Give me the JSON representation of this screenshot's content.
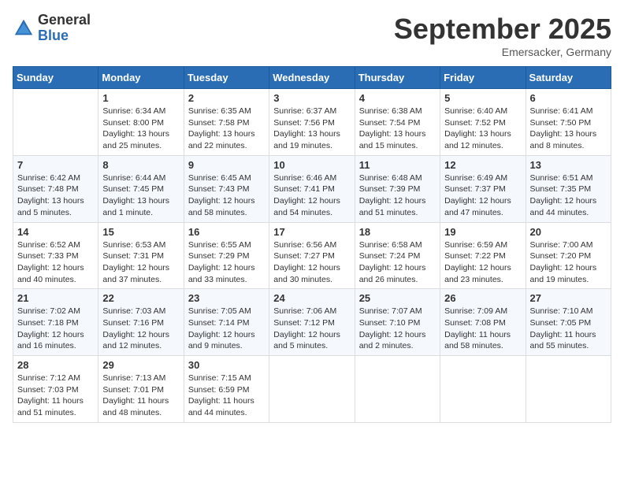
{
  "header": {
    "logo_general": "General",
    "logo_blue": "Blue",
    "month_title": "September 2025",
    "location": "Emersacker, Germany"
  },
  "weekdays": [
    "Sunday",
    "Monday",
    "Tuesday",
    "Wednesday",
    "Thursday",
    "Friday",
    "Saturday"
  ],
  "weeks": [
    [
      {
        "day": "",
        "info": ""
      },
      {
        "day": "1",
        "info": "Sunrise: 6:34 AM\nSunset: 8:00 PM\nDaylight: 13 hours\nand 25 minutes."
      },
      {
        "day": "2",
        "info": "Sunrise: 6:35 AM\nSunset: 7:58 PM\nDaylight: 13 hours\nand 22 minutes."
      },
      {
        "day": "3",
        "info": "Sunrise: 6:37 AM\nSunset: 7:56 PM\nDaylight: 13 hours\nand 19 minutes."
      },
      {
        "day": "4",
        "info": "Sunrise: 6:38 AM\nSunset: 7:54 PM\nDaylight: 13 hours\nand 15 minutes."
      },
      {
        "day": "5",
        "info": "Sunrise: 6:40 AM\nSunset: 7:52 PM\nDaylight: 13 hours\nand 12 minutes."
      },
      {
        "day": "6",
        "info": "Sunrise: 6:41 AM\nSunset: 7:50 PM\nDaylight: 13 hours\nand 8 minutes."
      }
    ],
    [
      {
        "day": "7",
        "info": "Sunrise: 6:42 AM\nSunset: 7:48 PM\nDaylight: 13 hours\nand 5 minutes."
      },
      {
        "day": "8",
        "info": "Sunrise: 6:44 AM\nSunset: 7:45 PM\nDaylight: 13 hours\nand 1 minute."
      },
      {
        "day": "9",
        "info": "Sunrise: 6:45 AM\nSunset: 7:43 PM\nDaylight: 12 hours\nand 58 minutes."
      },
      {
        "day": "10",
        "info": "Sunrise: 6:46 AM\nSunset: 7:41 PM\nDaylight: 12 hours\nand 54 minutes."
      },
      {
        "day": "11",
        "info": "Sunrise: 6:48 AM\nSunset: 7:39 PM\nDaylight: 12 hours\nand 51 minutes."
      },
      {
        "day": "12",
        "info": "Sunrise: 6:49 AM\nSunset: 7:37 PM\nDaylight: 12 hours\nand 47 minutes."
      },
      {
        "day": "13",
        "info": "Sunrise: 6:51 AM\nSunset: 7:35 PM\nDaylight: 12 hours\nand 44 minutes."
      }
    ],
    [
      {
        "day": "14",
        "info": "Sunrise: 6:52 AM\nSunset: 7:33 PM\nDaylight: 12 hours\nand 40 minutes."
      },
      {
        "day": "15",
        "info": "Sunrise: 6:53 AM\nSunset: 7:31 PM\nDaylight: 12 hours\nand 37 minutes."
      },
      {
        "day": "16",
        "info": "Sunrise: 6:55 AM\nSunset: 7:29 PM\nDaylight: 12 hours\nand 33 minutes."
      },
      {
        "day": "17",
        "info": "Sunrise: 6:56 AM\nSunset: 7:27 PM\nDaylight: 12 hours\nand 30 minutes."
      },
      {
        "day": "18",
        "info": "Sunrise: 6:58 AM\nSunset: 7:24 PM\nDaylight: 12 hours\nand 26 minutes."
      },
      {
        "day": "19",
        "info": "Sunrise: 6:59 AM\nSunset: 7:22 PM\nDaylight: 12 hours\nand 23 minutes."
      },
      {
        "day": "20",
        "info": "Sunrise: 7:00 AM\nSunset: 7:20 PM\nDaylight: 12 hours\nand 19 minutes."
      }
    ],
    [
      {
        "day": "21",
        "info": "Sunrise: 7:02 AM\nSunset: 7:18 PM\nDaylight: 12 hours\nand 16 minutes."
      },
      {
        "day": "22",
        "info": "Sunrise: 7:03 AM\nSunset: 7:16 PM\nDaylight: 12 hours\nand 12 minutes."
      },
      {
        "day": "23",
        "info": "Sunrise: 7:05 AM\nSunset: 7:14 PM\nDaylight: 12 hours\nand 9 minutes."
      },
      {
        "day": "24",
        "info": "Sunrise: 7:06 AM\nSunset: 7:12 PM\nDaylight: 12 hours\nand 5 minutes."
      },
      {
        "day": "25",
        "info": "Sunrise: 7:07 AM\nSunset: 7:10 PM\nDaylight: 12 hours\nand 2 minutes."
      },
      {
        "day": "26",
        "info": "Sunrise: 7:09 AM\nSunset: 7:08 PM\nDaylight: 11 hours\nand 58 minutes."
      },
      {
        "day": "27",
        "info": "Sunrise: 7:10 AM\nSunset: 7:05 PM\nDaylight: 11 hours\nand 55 minutes."
      }
    ],
    [
      {
        "day": "28",
        "info": "Sunrise: 7:12 AM\nSunset: 7:03 PM\nDaylight: 11 hours\nand 51 minutes."
      },
      {
        "day": "29",
        "info": "Sunrise: 7:13 AM\nSunset: 7:01 PM\nDaylight: 11 hours\nand 48 minutes."
      },
      {
        "day": "30",
        "info": "Sunrise: 7:15 AM\nSunset: 6:59 PM\nDaylight: 11 hours\nand 44 minutes."
      },
      {
        "day": "",
        "info": ""
      },
      {
        "day": "",
        "info": ""
      },
      {
        "day": "",
        "info": ""
      },
      {
        "day": "",
        "info": ""
      }
    ]
  ]
}
